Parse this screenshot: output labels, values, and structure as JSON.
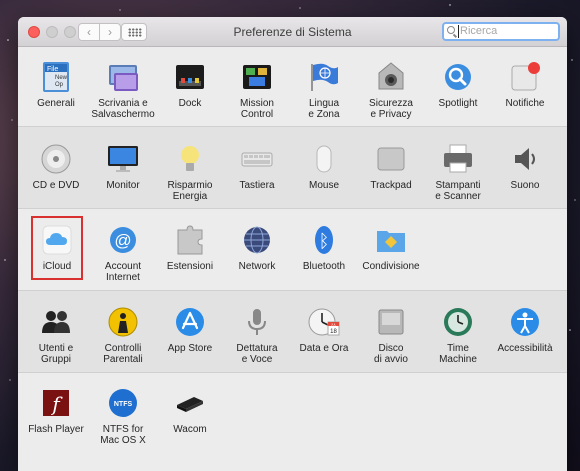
{
  "window": {
    "title": "Preferenze di Sistema",
    "search_placeholder": "Ricerca"
  },
  "sections": [
    [
      {
        "id": "generali",
        "label": "Generali",
        "icon": "general-icon"
      },
      {
        "id": "scrivania",
        "label": "Scrivania e\nSalvaschermo",
        "icon": "desktop-screensaver-icon"
      },
      {
        "id": "dock",
        "label": "Dock",
        "icon": "dock-icon"
      },
      {
        "id": "mission",
        "label": "Mission\nControl",
        "icon": "mission-control-icon"
      },
      {
        "id": "lingua",
        "label": "Lingua\ne Zona",
        "icon": "language-region-icon"
      },
      {
        "id": "sicurezza",
        "label": "Sicurezza\ne Privacy",
        "icon": "security-privacy-icon"
      },
      {
        "id": "spotlight",
        "label": "Spotlight",
        "icon": "spotlight-icon"
      },
      {
        "id": "notifiche",
        "label": "Notifiche",
        "icon": "notifications-icon"
      }
    ],
    [
      {
        "id": "cddvd",
        "label": "CD e DVD",
        "icon": "cd-dvd-icon"
      },
      {
        "id": "monitor",
        "label": "Monitor",
        "icon": "monitor-icon"
      },
      {
        "id": "risparmio",
        "label": "Risparmio\nEnergia",
        "icon": "energy-saver-icon"
      },
      {
        "id": "tastiera",
        "label": "Tastiera",
        "icon": "keyboard-icon"
      },
      {
        "id": "mouse",
        "label": "Mouse",
        "icon": "mouse-icon"
      },
      {
        "id": "trackpad",
        "label": "Trackpad",
        "icon": "trackpad-icon"
      },
      {
        "id": "stampanti",
        "label": "Stampanti\ne Scanner",
        "icon": "printer-icon"
      },
      {
        "id": "suono",
        "label": "Suono",
        "icon": "sound-icon"
      }
    ],
    [
      {
        "id": "icloud",
        "label": "iCloud",
        "icon": "icloud-icon",
        "highlighted": true
      },
      {
        "id": "account",
        "label": "Account\nInternet",
        "icon": "internet-accounts-icon"
      },
      {
        "id": "estensioni",
        "label": "Estensioni",
        "icon": "extensions-icon"
      },
      {
        "id": "network",
        "label": "Network",
        "icon": "network-icon"
      },
      {
        "id": "bluetooth",
        "label": "Bluetooth",
        "icon": "bluetooth-icon"
      },
      {
        "id": "condivisione",
        "label": "Condivisione",
        "icon": "sharing-icon"
      }
    ],
    [
      {
        "id": "utenti",
        "label": "Utenti e\nGruppi",
        "icon": "users-groups-icon"
      },
      {
        "id": "controlli",
        "label": "Controlli\nParentali",
        "icon": "parental-controls-icon"
      },
      {
        "id": "appstore",
        "label": "App Store",
        "icon": "app-store-icon"
      },
      {
        "id": "dettatura",
        "label": "Dettatura\ne Voce",
        "icon": "dictation-icon"
      },
      {
        "id": "dataora",
        "label": "Data e Ora",
        "icon": "date-time-icon"
      },
      {
        "id": "disco",
        "label": "Disco\ndi avvio",
        "icon": "startup-disk-icon"
      },
      {
        "id": "timemachine",
        "label": "Time\nMachine",
        "icon": "time-machine-icon"
      },
      {
        "id": "accessibilita",
        "label": "Accessibilità",
        "icon": "accessibility-icon"
      }
    ],
    [
      {
        "id": "flash",
        "label": "Flash Player",
        "icon": "flash-player-icon"
      },
      {
        "id": "ntfs",
        "label": "NTFS for\nMac OS X",
        "icon": "ntfs-icon"
      },
      {
        "id": "wacom",
        "label": "Wacom",
        "icon": "wacom-icon"
      }
    ]
  ],
  "icon_text": {
    "ntfs": "NTFS",
    "flash": "f",
    "general_file": "File",
    "general_new": "New",
    "general_op": "Op",
    "date_month": "JUL",
    "date_day": "18",
    "bluetooth": "ᛒ",
    "account_at": "@"
  },
  "colors": {
    "highlight": "#d93030",
    "close": "#fc605c",
    "search_focus": "#7eb1ef"
  }
}
